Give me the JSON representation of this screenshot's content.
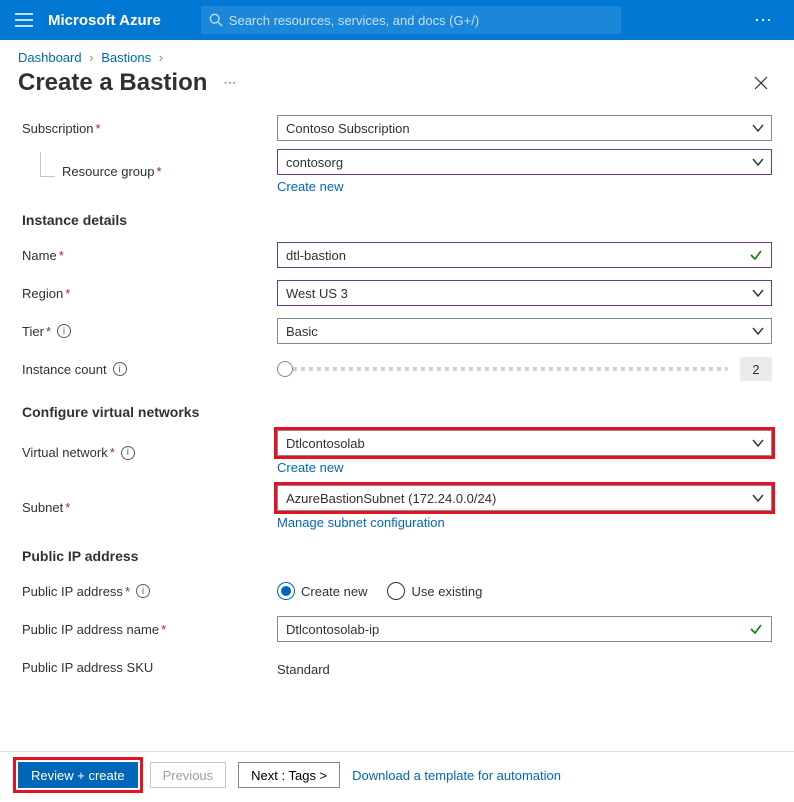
{
  "topbar": {
    "brand": "Microsoft Azure",
    "search_placeholder": "Search resources, services, and docs (G+/)"
  },
  "breadcrumb": {
    "items": [
      "Dashboard",
      "Bastions"
    ]
  },
  "page": {
    "title": "Create a Bastion"
  },
  "form": {
    "subscription": {
      "label": "Subscription",
      "value": "Contoso Subscription"
    },
    "resource_group": {
      "label": "Resource group",
      "value": "contosorg",
      "create_new": "Create new"
    },
    "instance_details_h": "Instance details",
    "name": {
      "label": "Name",
      "value": "dtl-bastion"
    },
    "region": {
      "label": "Region",
      "value": "West US 3"
    },
    "tier": {
      "label": "Tier",
      "value": "Basic"
    },
    "instance_count": {
      "label": "Instance count",
      "value": "2"
    },
    "vnet_h": "Configure virtual networks",
    "vnet": {
      "label": "Virtual network",
      "value": "Dtlcontosolab",
      "create_new": "Create new"
    },
    "subnet": {
      "label": "Subnet",
      "value": "AzureBastionSubnet (172.24.0.0/24)",
      "manage": "Manage subnet configuration"
    },
    "pip_h": "Public IP address",
    "pip_mode": {
      "label": "Public IP address",
      "opt_new": "Create new",
      "opt_existing": "Use existing"
    },
    "pip_name": {
      "label": "Public IP address name",
      "value": "Dtlcontosolab-ip"
    },
    "pip_sku": {
      "label": "Public IP address SKU",
      "value": "Standard"
    }
  },
  "footer": {
    "review": "Review + create",
    "previous": "Previous",
    "next": "Next : Tags >",
    "download": "Download a template for automation"
  }
}
